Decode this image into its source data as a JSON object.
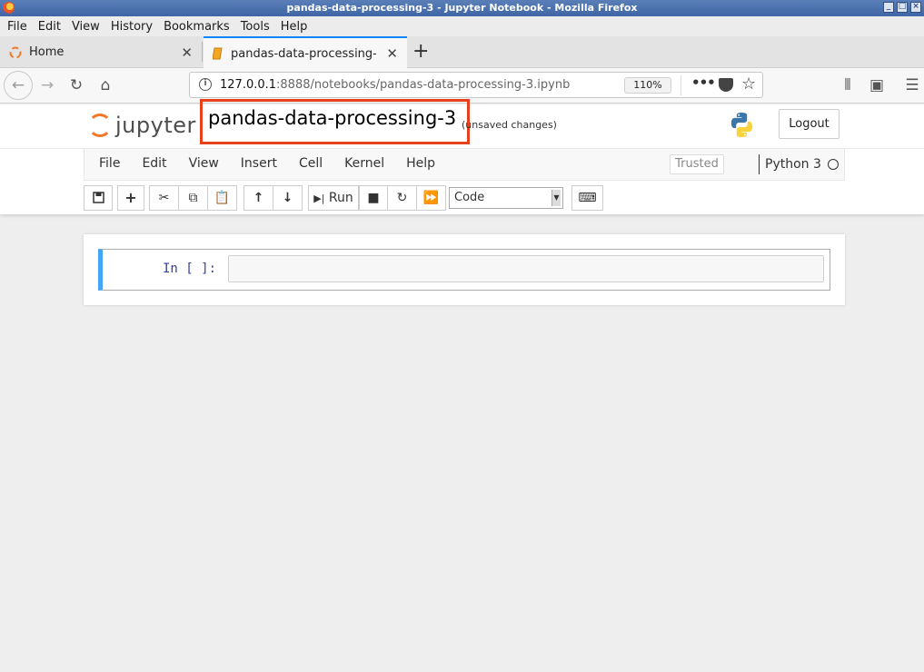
{
  "window": {
    "title": "pandas-data-processing-3 - Jupyter Notebook - Mozilla Firefox"
  },
  "browser_menu": [
    "File",
    "Edit",
    "View",
    "History",
    "Bookmarks",
    "Tools",
    "Help"
  ],
  "tabs": [
    {
      "label": "Home",
      "active": false
    },
    {
      "label": "pandas-data-processing-",
      "active": true
    }
  ],
  "address_bar": {
    "host": "127.0.0.1",
    "rest": ":8888/notebooks/pandas-data-processing-3.ipynb",
    "zoom": "110%"
  },
  "jupyter": {
    "logo_text": "jupyter",
    "notebook_name": "pandas-data-processing-3",
    "save_status": "(unsaved changes)",
    "logout_label": "Logout",
    "menu": [
      "File",
      "Edit",
      "View",
      "Insert",
      "Cell",
      "Kernel",
      "Help"
    ],
    "trusted_label": "Trusted",
    "kernel_name": "Python 3",
    "toolbar": {
      "run_label": "Run",
      "cell_type": "Code"
    },
    "cell": {
      "prompt": "In [ ]:",
      "source": ""
    }
  },
  "colors": {
    "highlight_box": "#e8401c",
    "cell_selected_border": "#42a5f5",
    "jupyter_orange": "#f37726"
  }
}
